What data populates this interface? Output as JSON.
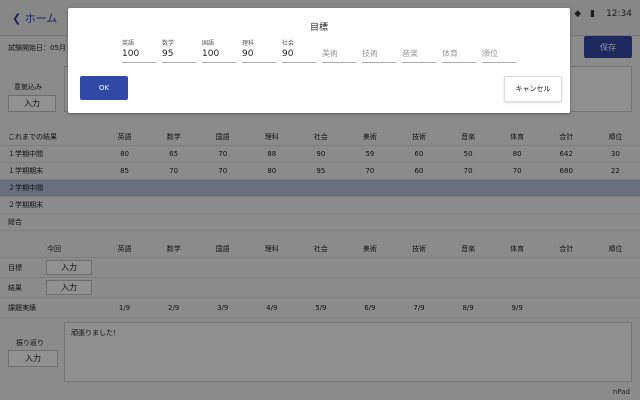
{
  "topbar": {
    "back_label": "ホーム",
    "status_icons": "▼ ◆ ▮",
    "time": "12:34"
  },
  "header": {
    "exam_start": "試験開始日：05月",
    "save_label": "保存"
  },
  "motivation": {
    "label": "意気込み",
    "button": "入力"
  },
  "results": {
    "headers": [
      "これまでの結果",
      "英語",
      "数学",
      "国語",
      "理科",
      "社会",
      "美術",
      "技術",
      "音楽",
      "体育",
      "合計",
      "順位"
    ],
    "rows": [
      [
        "１学期中間",
        "80",
        "65",
        "70",
        "88",
        "90",
        "59",
        "60",
        "50",
        "80",
        "642",
        "30"
      ],
      [
        "１学期期末",
        "85",
        "70",
        "70",
        "80",
        "95",
        "70",
        "60",
        "70",
        "70",
        "680",
        "22"
      ],
      [
        "２学期中間",
        "",
        "",
        "",
        "",
        "",
        "",
        "",
        "",
        "",
        "",
        ""
      ],
      [
        "２学期期末",
        "",
        "",
        "",
        "",
        "",
        "",
        "",
        "",
        "",
        "",
        ""
      ],
      [
        "総合",
        "",
        "",
        "",
        "",
        "",
        "",
        "",
        "",
        "",
        "",
        ""
      ]
    ]
  },
  "current": {
    "headers": [
      "今回",
      "英語",
      "数学",
      "国語",
      "理科",
      "社会",
      "美術",
      "技術",
      "音楽",
      "体育",
      "合計",
      "順位"
    ],
    "target_label": "目標",
    "result_label": "結果",
    "input_label": "入力",
    "assignment_label": "課題実績",
    "assignments": [
      "1/9",
      "2/9",
      "3/9",
      "4/9",
      "5/9",
      "6/9",
      "7/9",
      "8/9",
      "9/9"
    ]
  },
  "reflection": {
    "label": "振り返り",
    "button": "入力",
    "text": "頑張りました！"
  },
  "footer": {
    "brand": "nPad"
  },
  "dialog": {
    "title": "目標",
    "fields": [
      {
        "label": "英語",
        "value": "100",
        "placeholder": ""
      },
      {
        "label": "数学",
        "value": "95",
        "placeholder": ""
      },
      {
        "label": "国語",
        "value": "100",
        "placeholder": ""
      },
      {
        "label": "理科",
        "value": "90",
        "placeholder": ""
      },
      {
        "label": "社会",
        "value": "90",
        "placeholder": ""
      },
      {
        "label": "",
        "value": "",
        "placeholder": "美術"
      },
      {
        "label": "",
        "value": "",
        "placeholder": "技術"
      },
      {
        "label": "",
        "value": "",
        "placeholder": "音楽"
      },
      {
        "label": "",
        "value": "",
        "placeholder": "体育"
      },
      {
        "label": "",
        "value": "",
        "placeholder": "順位"
      }
    ],
    "ok_label": "OK",
    "cancel_label": "キャンセル"
  },
  "colors": {
    "accent": "#3149a6",
    "highlight_row": "#b8bddf",
    "overlay": "#000000"
  }
}
